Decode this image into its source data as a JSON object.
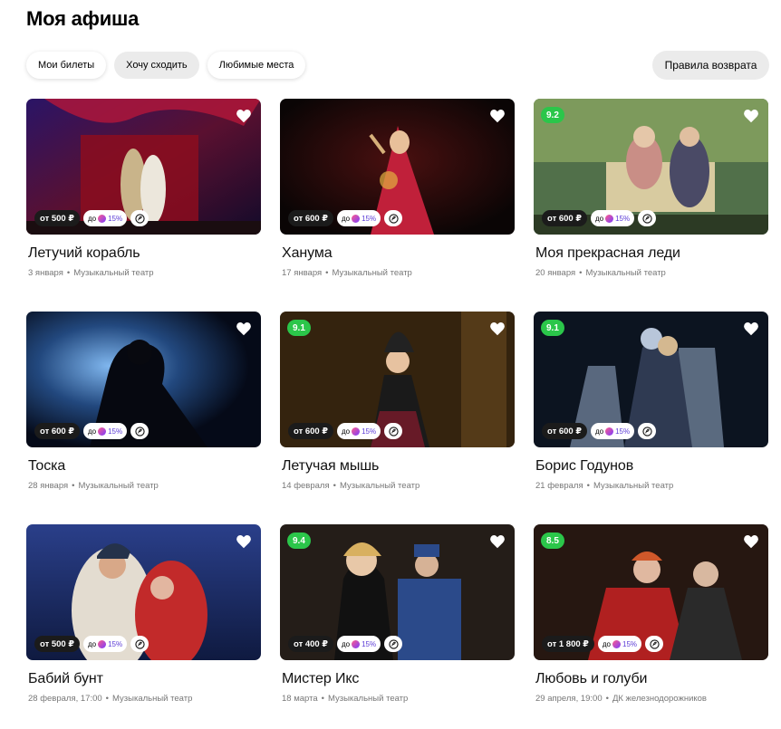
{
  "header": {
    "title": "Моя афиша"
  },
  "tabs": [
    {
      "label": "Мои билеты",
      "active": false
    },
    {
      "label": "Хочу сходить",
      "active": true
    },
    {
      "label": "Любимые места",
      "active": false
    }
  ],
  "refund_button": {
    "label": "Правила возврата"
  },
  "colors": {
    "rating_bg": "#2bc64a",
    "price_bg": "#1b1b1b",
    "chip_bg": "#ebebeb",
    "promo_text": "#5b3bd6"
  },
  "icons": {
    "favorite": "heart-icon",
    "promo": "plus-icon",
    "pushkin_card": "pushkin-card-icon"
  },
  "cards": [
    {
      "title": "Летучий корабль",
      "date": "3 января",
      "venue": "Музыкальный театр",
      "price": "от 500 ₽",
      "promo_prefix": "до",
      "promo_value": "15%",
      "rating": "",
      "theme": "a"
    },
    {
      "title": "Ханума",
      "date": "17 января",
      "venue": "Музыкальный театр",
      "price": "от 600 ₽",
      "promo_prefix": "до",
      "promo_value": "15%",
      "rating": "",
      "theme": "b"
    },
    {
      "title": "Моя прекрасная леди",
      "date": "20 января",
      "venue": "Музыкальный театр",
      "price": "от 600 ₽",
      "promo_prefix": "до",
      "promo_value": "15%",
      "rating": "9.2",
      "theme": "c"
    },
    {
      "title": "Тоска",
      "date": "28 января",
      "venue": "Музыкальный театр",
      "price": "от 600 ₽",
      "promo_prefix": "до",
      "promo_value": "15%",
      "rating": "",
      "theme": "d"
    },
    {
      "title": "Летучая мышь",
      "date": "14 февраля",
      "venue": "Музыкальный театр",
      "price": "от 600 ₽",
      "promo_prefix": "до",
      "promo_value": "15%",
      "rating": "9.1",
      "theme": "e"
    },
    {
      "title": "Борис Годунов",
      "date": "21 февраля",
      "venue": "Музыкальный театр",
      "price": "от 600 ₽",
      "promo_prefix": "до",
      "promo_value": "15%",
      "rating": "9.1",
      "theme": "f"
    },
    {
      "title": "Бабий бунт",
      "date": "28 февраля, 17:00",
      "venue": "Музыкальный театр",
      "price": "от 500 ₽",
      "promo_prefix": "до",
      "promo_value": "15%",
      "rating": "",
      "theme": "g"
    },
    {
      "title": "Мистер Икс",
      "date": "18 марта",
      "venue": "Музыкальный театр",
      "price": "от 400 ₽",
      "promo_prefix": "до",
      "promo_value": "15%",
      "rating": "9.4",
      "theme": "h"
    },
    {
      "title": "Любовь и голуби",
      "date": "29 апреля, 19:00",
      "venue": "ДК железнодорожников",
      "price": "от 1 800 ₽",
      "promo_prefix": "до",
      "promo_value": "15%",
      "rating": "8.5",
      "theme": "i"
    }
  ]
}
